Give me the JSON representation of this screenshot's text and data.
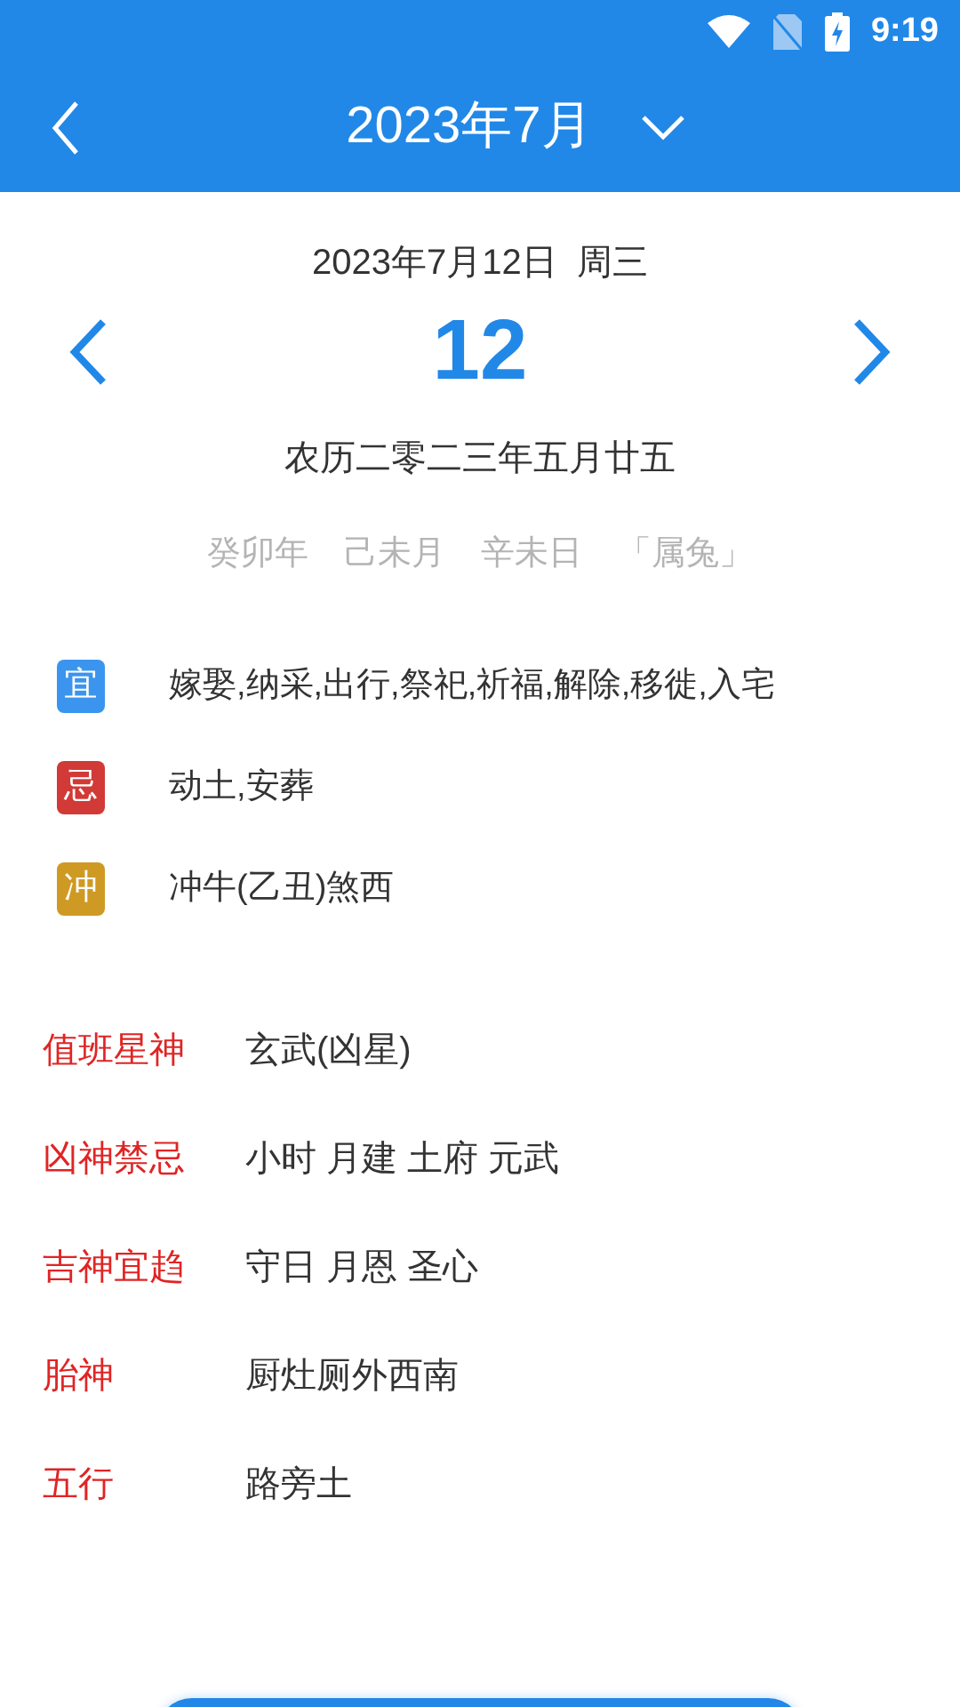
{
  "status_bar": {
    "time": "9:19"
  },
  "toolbar": {
    "title": "2023年7月"
  },
  "date_header": {
    "date": "2023年7月12日  周三",
    "day": "12",
    "lunar": "农历二零二三年五月廿五",
    "ganzhi": [
      "癸卯年",
      "己未月",
      "辛未日",
      "「属兔」"
    ]
  },
  "almanac": [
    {
      "tag": "宜",
      "color": "#3b95ee",
      "text": "嫁娶,纳采,出行,祭祀,祈福,解除,移徙,入宅"
    },
    {
      "tag": "忌",
      "color": "#d13a36",
      "text": "动土,安葬"
    },
    {
      "tag": "冲",
      "color": "#cf9a24",
      "text": "冲牛(乙丑)煞西"
    }
  ],
  "details": [
    {
      "label": "值班星神",
      "value": "玄武(凶星)"
    },
    {
      "label": "凶神禁忌",
      "value": "小时 月建 土府 元武"
    },
    {
      "label": "吉神宜趋",
      "value": "守日 月恩 圣心"
    },
    {
      "label": "胎神",
      "value": "厨灶厕外西南"
    },
    {
      "label": "五行",
      "value": "路旁土"
    }
  ]
}
